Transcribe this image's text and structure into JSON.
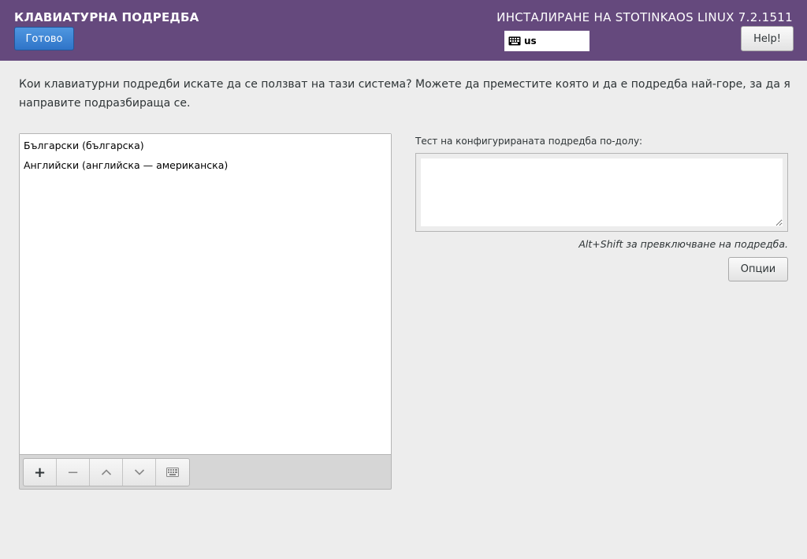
{
  "header": {
    "spoke_title": "КЛАВИАТУРНА ПОДРЕДБА",
    "done_label": "Готово",
    "product_title": "ИНСТАЛИРАНЕ НА STOTINKAOS LINUX 7.2.1511",
    "keyboard_indicator": "us",
    "help_label": "Help!",
    "bg_color": "#65497d"
  },
  "question": "Кои клавиатурни подредби искате да се ползват на тази система?  Можете да преместите която и да е подредба най-горе, за да я направите подразбираща се.",
  "layouts": {
    "items": [
      {
        "label": "Български (българска)"
      },
      {
        "label": "Английски (английска — американска)"
      }
    ],
    "toolbar": [
      {
        "icon": "plus-icon",
        "glyph": "+"
      },
      {
        "icon": "minus-icon",
        "glyph": "−"
      },
      {
        "icon": "chevron-up-icon"
      },
      {
        "icon": "chevron-down-icon"
      },
      {
        "icon": "keyboard-icon"
      }
    ]
  },
  "test": {
    "label": "Тест на конфигурираната подредба по-долу:",
    "value": ""
  },
  "switch_hint": "Alt+Shift за превключване на подредба.",
  "options_label": "Опции"
}
